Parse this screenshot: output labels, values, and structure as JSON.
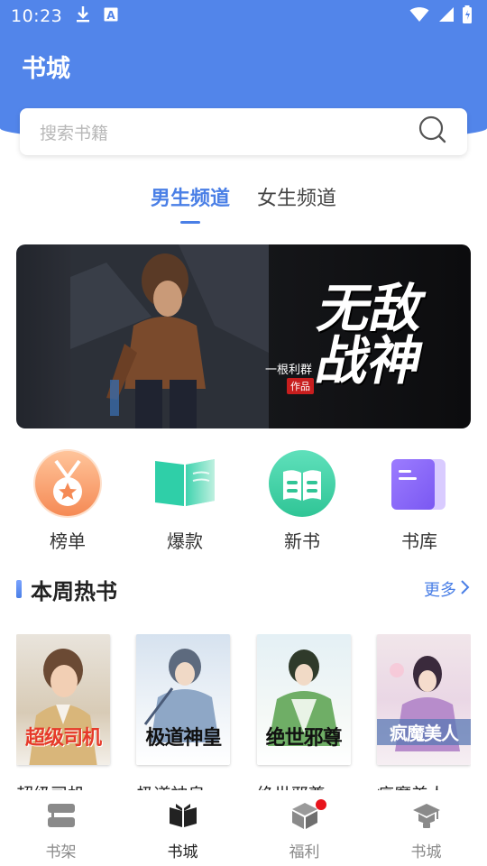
{
  "status_bar": {
    "time": "10:23",
    "icons": [
      "download-icon",
      "a-box-icon",
      "wifi-icon",
      "signal-icon",
      "battery-icon"
    ]
  },
  "header": {
    "title": "书城"
  },
  "search": {
    "placeholder": "搜索书籍",
    "icon": "search-icon"
  },
  "channels": [
    {
      "label": "男生频道",
      "active": true
    },
    {
      "label": "女生频道",
      "active": false
    }
  ],
  "banner": {
    "title_line1": "无敌",
    "title_line2": "战神",
    "author": "一根利群",
    "author_tag": "作品"
  },
  "quick_menu": [
    {
      "label": "榜单",
      "icon": "medal-icon"
    },
    {
      "label": "爆款",
      "icon": "open-book-icon"
    },
    {
      "label": "新书",
      "icon": "new-book-icon"
    },
    {
      "label": "书库",
      "icon": "library-icon"
    }
  ],
  "hot_section": {
    "title": "本周热书",
    "more": "更多"
  },
  "books": [
    {
      "name": "超级司机",
      "cover_title": "超级司机"
    },
    {
      "name": "极道神皇",
      "cover_title": "极道神皇"
    },
    {
      "name": "绝世邪尊",
      "cover_title": "绝世邪尊"
    },
    {
      "name": "疯魔美人",
      "cover_title": "疯魔美人"
    }
  ],
  "tab_bar": [
    {
      "label": "书架",
      "icon": "bookshelf-icon",
      "active": false,
      "badge": false
    },
    {
      "label": "书城",
      "icon": "book-city-icon",
      "active": true,
      "badge": false
    },
    {
      "label": "福利",
      "icon": "gift-box-icon",
      "active": false,
      "badge": true
    },
    {
      "label": "书城",
      "icon": "graduation-icon",
      "active": false,
      "badge": false
    }
  ],
  "colors": {
    "brand_blue": "#5285ea",
    "accent_blue": "#4a7fe6",
    "badge_red": "#e8141c"
  }
}
